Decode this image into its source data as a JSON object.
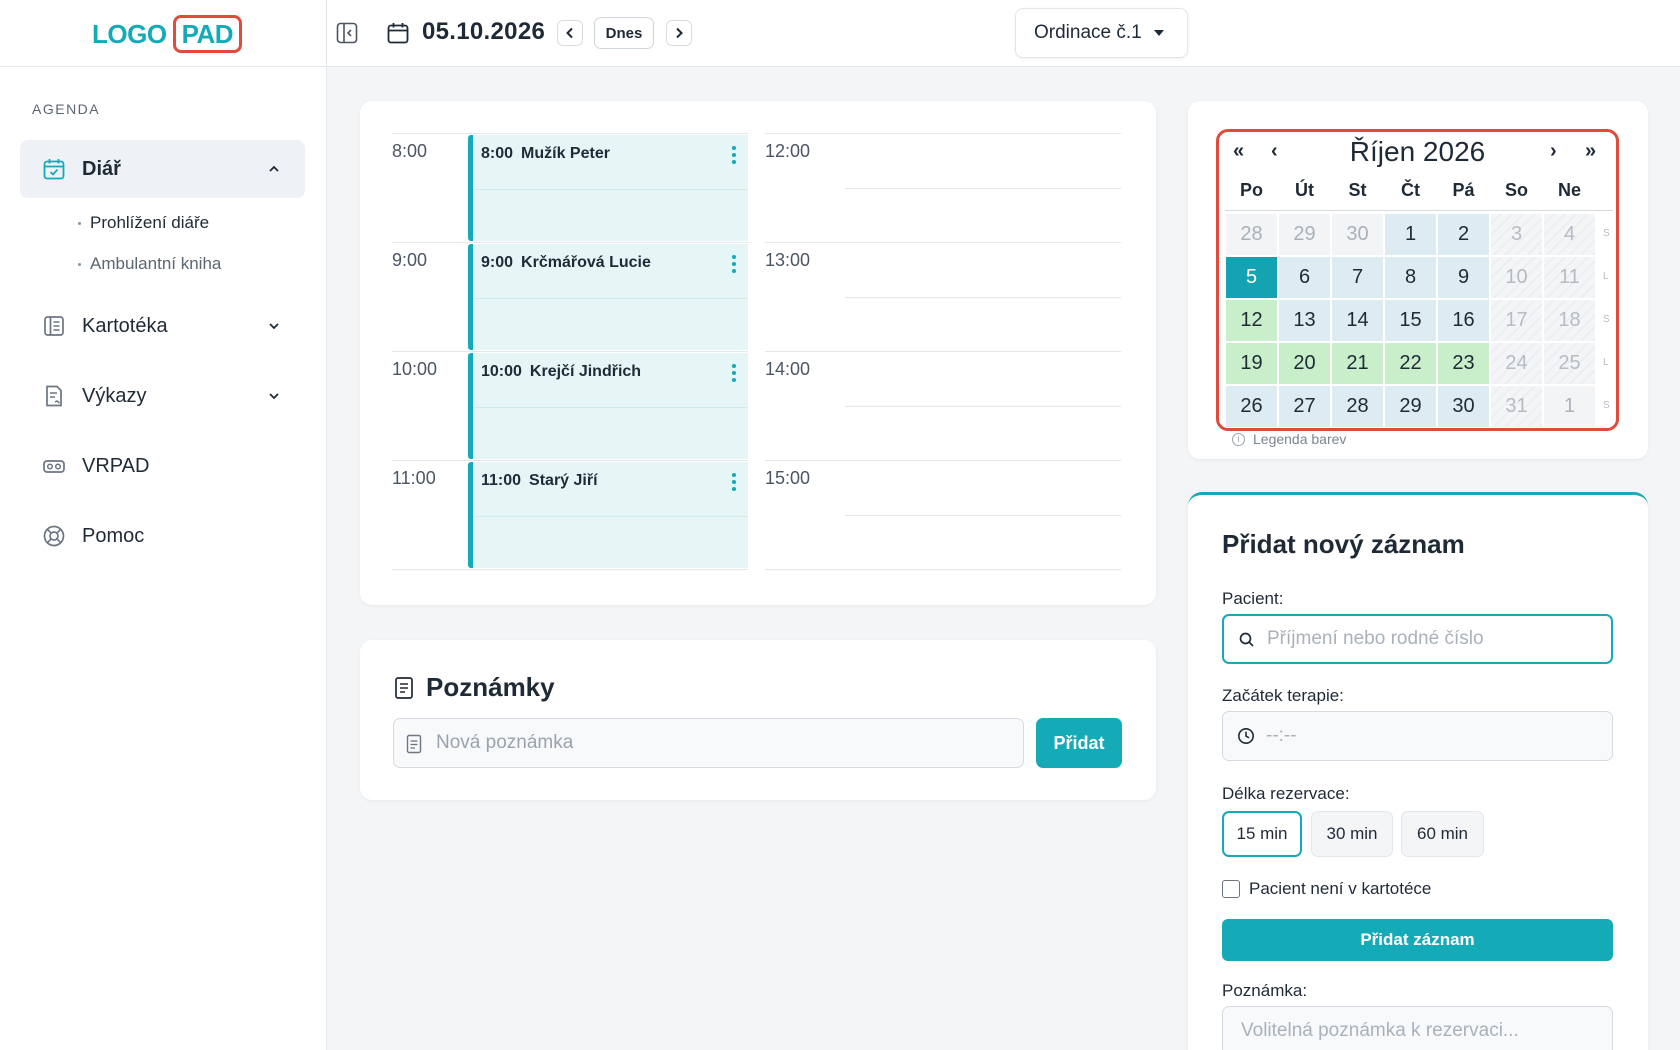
{
  "header": {
    "logo_left": "LOGO",
    "logo_right": "PAD",
    "date": "05.10.2026",
    "today_label": "Dnes",
    "office": "Ordinace č.1"
  },
  "sidebar": {
    "section_label": "AGENDA",
    "items": [
      {
        "label": "Diář",
        "icon": "calendar-check-icon",
        "active": true
      },
      {
        "label": "Kartotéka",
        "icon": "card-file-icon"
      },
      {
        "label": "Výkazy",
        "icon": "report-icon"
      },
      {
        "label": "VRPAD",
        "icon": "vr-headset-icon"
      },
      {
        "label": "Pomoc",
        "icon": "lifebuoy-icon"
      }
    ],
    "sub_items": [
      {
        "label": "Prohlížení diáře",
        "active": true
      },
      {
        "label": "Ambulantní kniha"
      }
    ]
  },
  "schedule": {
    "left_times": [
      "8:00",
      "9:00",
      "10:00",
      "11:00"
    ],
    "right_times": [
      "12:00",
      "13:00",
      "14:00",
      "15:00"
    ],
    "appointments": [
      {
        "time": "8:00",
        "name": "Mužík Peter"
      },
      {
        "time": "9:00",
        "name": "Krčmářová Lucie"
      },
      {
        "time": "10:00",
        "name": "Krejčí Jindřich"
      },
      {
        "time": "11:00",
        "name": "Starý Jiří"
      }
    ],
    "accent_color": "#14aab8"
  },
  "notes": {
    "title": "Poznámky",
    "placeholder": "Nová poznámka",
    "add_label": "Přidat"
  },
  "mini_calendar": {
    "prev_year": "«",
    "prev_month": "‹",
    "title": "Říjen 2026",
    "next_month": "›",
    "next_year": "»",
    "weekdays": [
      "Po",
      "Út",
      "St",
      "Čt",
      "Pá",
      "So",
      "Ne"
    ],
    "edge_letters": [
      "S",
      "L",
      "S",
      "L",
      "S"
    ],
    "weeks": [
      [
        {
          "d": "28",
          "s": "out"
        },
        {
          "d": "29",
          "s": "out"
        },
        {
          "d": "30",
          "s": "out"
        },
        {
          "d": "1",
          "s": "blue"
        },
        {
          "d": "2",
          "s": "blue"
        },
        {
          "d": "3",
          "s": "weekend"
        },
        {
          "d": "4",
          "s": "weekend"
        }
      ],
      [
        {
          "d": "5",
          "s": "selected"
        },
        {
          "d": "6",
          "s": "blue"
        },
        {
          "d": "7",
          "s": "blue"
        },
        {
          "d": "8",
          "s": "blue"
        },
        {
          "d": "9",
          "s": "blue"
        },
        {
          "d": "10",
          "s": "weekend"
        },
        {
          "d": "11",
          "s": "weekend"
        }
      ],
      [
        {
          "d": "12",
          "s": "green"
        },
        {
          "d": "13",
          "s": "blue"
        },
        {
          "d": "14",
          "s": "blue"
        },
        {
          "d": "15",
          "s": "blue"
        },
        {
          "d": "16",
          "s": "blue"
        },
        {
          "d": "17",
          "s": "weekend"
        },
        {
          "d": "18",
          "s": "weekend"
        }
      ],
      [
        {
          "d": "19",
          "s": "green"
        },
        {
          "d": "20",
          "s": "green"
        },
        {
          "d": "21",
          "s": "green"
        },
        {
          "d": "22",
          "s": "green"
        },
        {
          "d": "23",
          "s": "green"
        },
        {
          "d": "24",
          "s": "weekend"
        },
        {
          "d": "25",
          "s": "weekend"
        }
      ],
      [
        {
          "d": "26",
          "s": "blue"
        },
        {
          "d": "27",
          "s": "blue"
        },
        {
          "d": "28",
          "s": "blue"
        },
        {
          "d": "29",
          "s": "blue"
        },
        {
          "d": "30",
          "s": "blue"
        },
        {
          "d": "31",
          "s": "weekend"
        },
        {
          "d": "1",
          "s": "out"
        }
      ]
    ],
    "legend": "Legenda barev",
    "highlight_color": "#e04b3c"
  },
  "add_record": {
    "title": "Přidat nový záznam",
    "patient_label": "Pacient:",
    "patient_placeholder": "Příjmení nebo rodné číslo",
    "start_label": "Začátek terapie:",
    "start_placeholder": "--:--",
    "duration_label": "Délka rezervace:",
    "durations": [
      "15 min",
      "30 min",
      "60 min"
    ],
    "selected_duration": "15 min",
    "not_in_file_label": "Pacient není v kartotéce",
    "submit_label": "Přidat záznam",
    "note_label": "Poznámka:",
    "note_placeholder": "Volitelná poznámka k rezervaci..."
  }
}
